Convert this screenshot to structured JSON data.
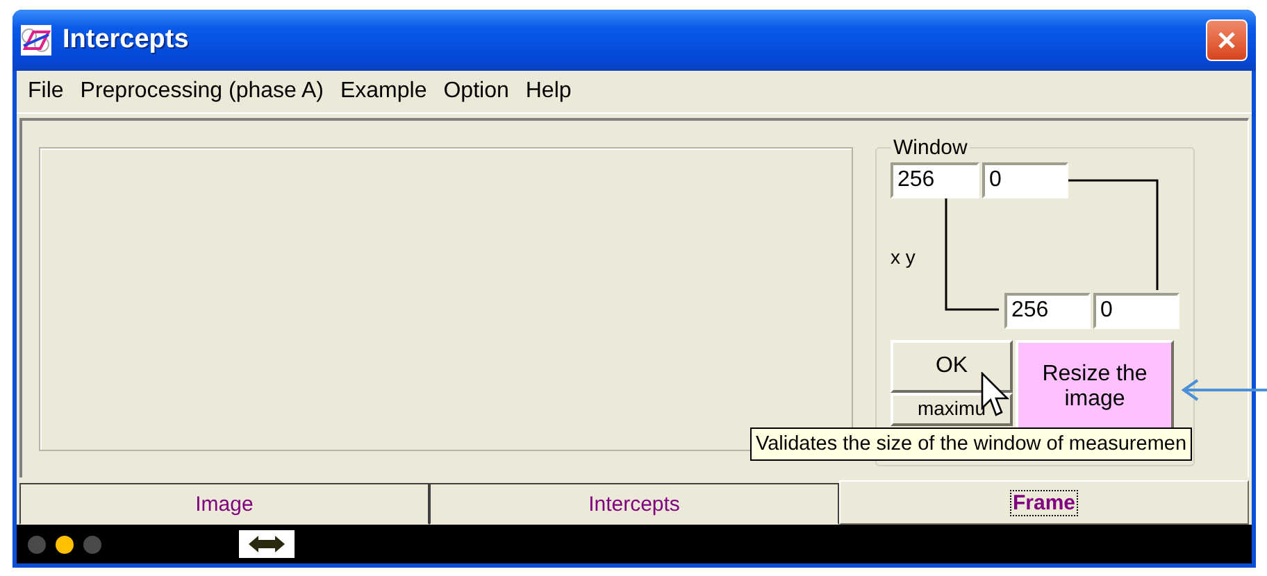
{
  "window": {
    "title": "Intercepts"
  },
  "menu": [
    "File",
    "Preprocessing (phase A)",
    "Example",
    "Option",
    "Help"
  ],
  "group": {
    "title": "Window",
    "top_fields": [
      "256",
      "0"
    ],
    "axis_label": "x y",
    "bottom_fields": [
      "256",
      "0"
    ]
  },
  "buttons": {
    "ok": "OK",
    "maximum": "maximu",
    "resize": "Resize the image"
  },
  "tooltip": "Validates the size of the window of measuremen",
  "tabs": [
    {
      "label": "Image",
      "selected": false
    },
    {
      "label": "Intercepts",
      "selected": false
    },
    {
      "label": "Frame",
      "selected": true
    }
  ],
  "status_dots": [
    {
      "color": "#4a4a4a"
    },
    {
      "color": "#ffc000"
    },
    {
      "color": "#4a4a4a"
    }
  ]
}
